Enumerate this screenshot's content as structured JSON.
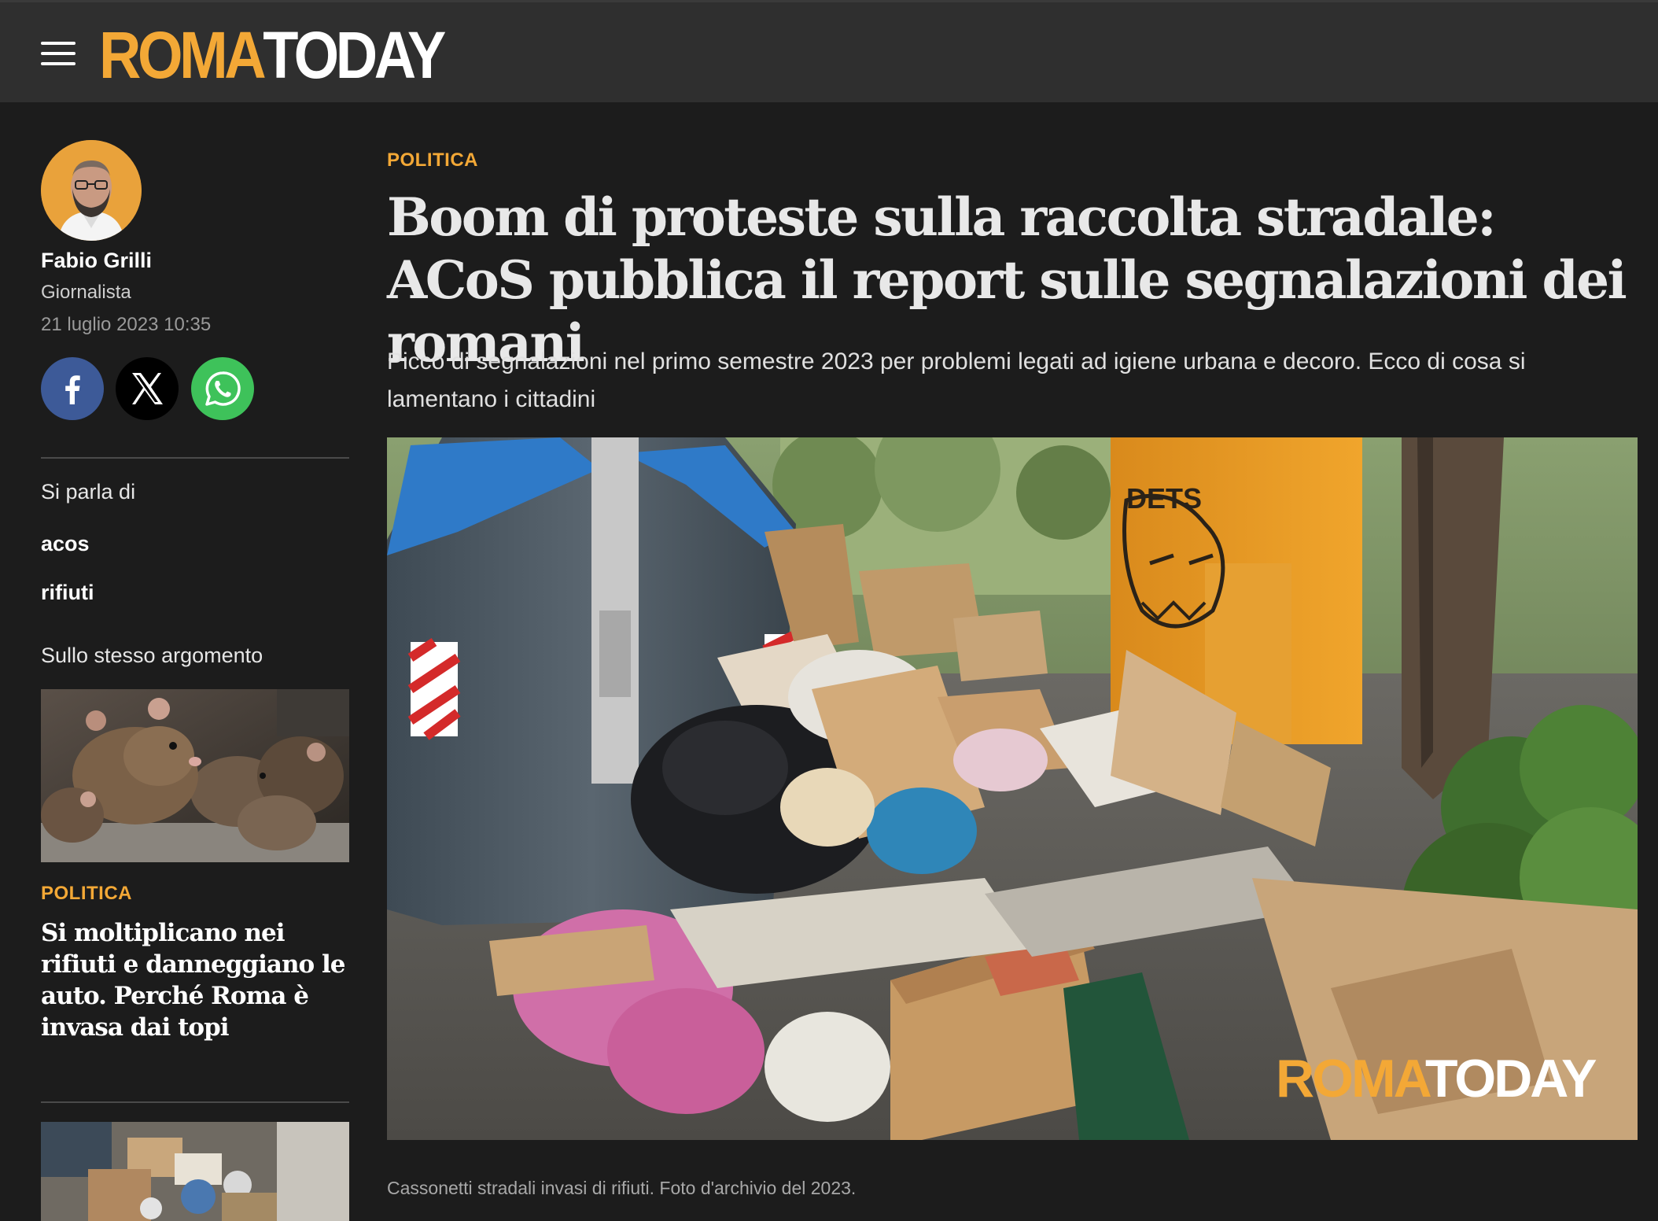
{
  "header": {
    "menu_icon": "hamburger-menu-icon",
    "logo_part1": "ROMA",
    "logo_part2": "TODAY",
    "logo_colors": {
      "roma": "#f3a836",
      "today": "#ffffff"
    }
  },
  "author": {
    "name": "Fabio Grilli",
    "role": "Giornalista",
    "date": "21 luglio 2023 10:35"
  },
  "share": [
    {
      "network": "facebook",
      "icon": "facebook-icon",
      "color": "#3d5a98"
    },
    {
      "network": "x",
      "icon": "x-icon",
      "color": "#000000"
    },
    {
      "network": "whatsapp",
      "icon": "whatsapp-icon",
      "color": "#3ec25a"
    }
  ],
  "sidebar": {
    "topics_label": "Si parla di",
    "tags": [
      "acos",
      "rifiuti"
    ],
    "related_label": "Sullo stesso argomento",
    "related": [
      {
        "category": "POLITICA",
        "title": "Si moltiplicano nei rifiuti e danneggiano le auto. Perché Roma è invasa dai topi"
      }
    ]
  },
  "article": {
    "category": "POLITICA",
    "headline": "Boom di proteste sulla raccolta stradale: ACoS pubblica il report sulle segnalazioni dei romani",
    "subtitle": "Picco di segnalazioni nel primo semestre 2023 per problemi legati ad igiene urbana e decoro. Ecco di cosa si lamentano i cittadini",
    "photo_caption": "Cassonetti stradali invasi di rifiuti. Foto d'archivio del 2023.",
    "watermark_part1": "ROMA",
    "watermark_part2": "TODAY"
  },
  "colors": {
    "accent": "#f3a836",
    "background": "#1c1c1c",
    "header_bg": "#2f2f2f"
  }
}
